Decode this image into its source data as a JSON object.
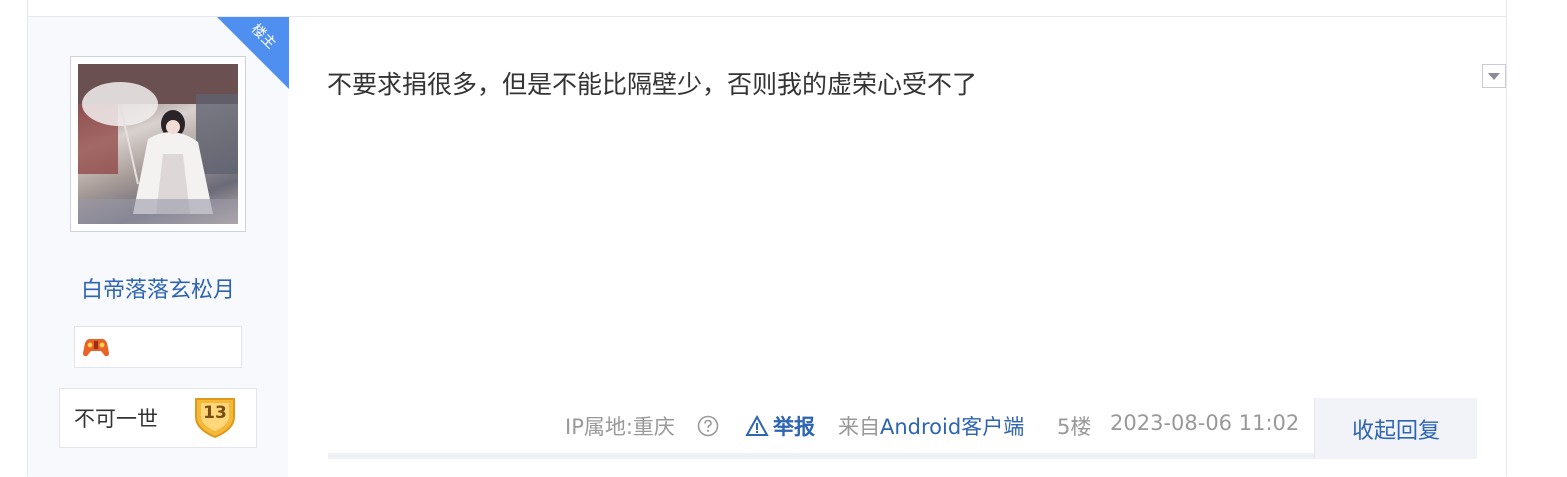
{
  "post": {
    "op_badge": "楼主",
    "author": {
      "username": "白帝落落玄松月",
      "level_name": "不可一世",
      "level_number": "13"
    },
    "content": "不要求捐很多，但是不能比隔壁少，否则我的虚荣心受不了",
    "footer": {
      "ip_location": "IP属地:重庆",
      "report": "举报",
      "source_prefix": "来自",
      "source_client": "Android客户端",
      "floor": "5楼",
      "timestamp": "2023-08-06 11:02",
      "collapse_reply": "收起回复"
    }
  },
  "colors": {
    "link_blue": "#2d64b3",
    "op_badge_blue": "#4f8ff0",
    "level_badge_gold": "#f5b93a",
    "meta_gray": "#999999"
  },
  "icons": {
    "help": "question-circle-icon",
    "report": "warning-triangle-icon",
    "dropdown": "caret-down-icon",
    "fan_badge": "gamepad-icon"
  }
}
